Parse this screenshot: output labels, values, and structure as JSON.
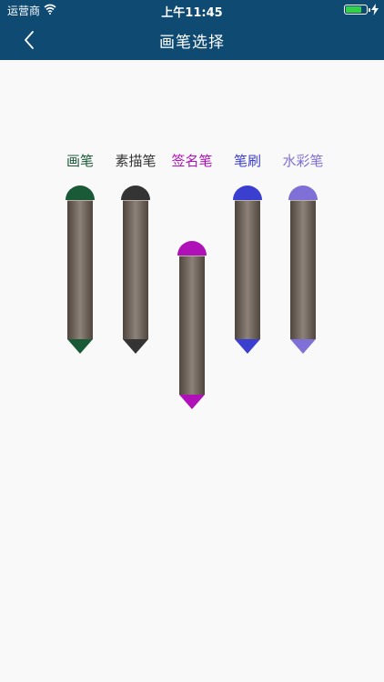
{
  "status": {
    "carrier": "运营商",
    "time": "上午11:45"
  },
  "nav": {
    "title": "画笔选择"
  },
  "pens": [
    {
      "label": "画笔",
      "color": "#1a5a37"
    },
    {
      "label": "素描笔",
      "color": "#343434"
    },
    {
      "label": "签名笔",
      "color": "#b010b8"
    },
    {
      "label": "笔刷",
      "color": "#3b3fd0"
    },
    {
      "label": "水彩笔",
      "color": "#7e70d6"
    }
  ],
  "icons": {
    "back": "chevron-left-icon",
    "wifi": "wifi-icon",
    "battery": "battery-icon",
    "charging": "bolt-icon"
  }
}
